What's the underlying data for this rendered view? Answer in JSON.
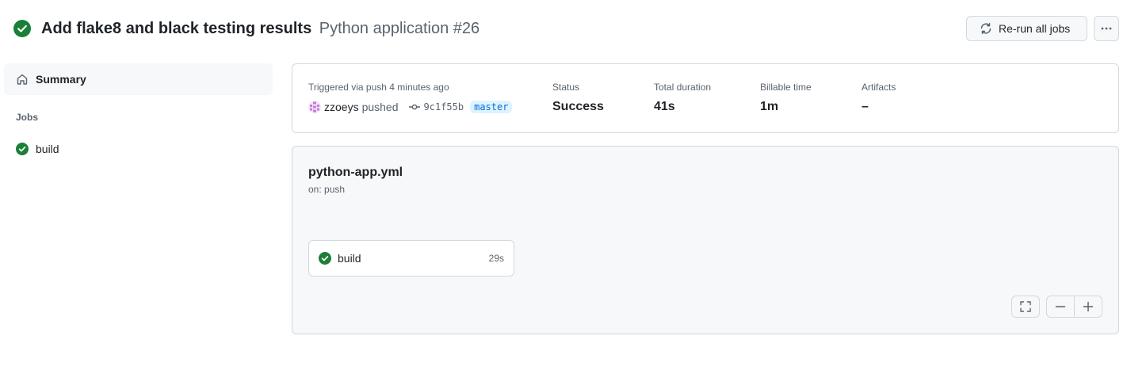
{
  "header": {
    "title": "Add flake8 and black testing results",
    "subtitle": "Python application #26",
    "rerun_label": "Re-run all jobs",
    "more_icon": "kebab-horizontal-icon",
    "status_icon": "check-circle-fill-icon"
  },
  "sidebar": {
    "summary_label": "Summary",
    "summary_icon": "home-icon",
    "jobs_heading": "Jobs",
    "jobs": [
      {
        "label": "build",
        "status": "success"
      }
    ]
  },
  "run_summary": {
    "triggered_label": "Triggered via push 4 minutes ago",
    "actor": "zzoeys",
    "action": "pushed",
    "commit_sha": "9c1f55b",
    "branch": "master",
    "stats": [
      {
        "label": "Status",
        "value": "Success"
      },
      {
        "label": "Total duration",
        "value": "41s"
      },
      {
        "label": "Billable time",
        "value": "1m"
      },
      {
        "label": "Artifacts",
        "value": "–"
      }
    ]
  },
  "workflow": {
    "file": "python-app.yml",
    "trigger": "on: push",
    "jobs": [
      {
        "name": "build",
        "duration": "29s",
        "status": "success"
      }
    ],
    "controls": {
      "fit_icon": "screen-full-icon",
      "zoom_out_icon": "dash-icon",
      "zoom_in_icon": "plus-icon"
    }
  },
  "colors": {
    "success": "#1a7f37",
    "border": "#d1d9e0",
    "muted_text": "#59636e",
    "branch_bg": "#ddf4ff",
    "branch_text": "#0969da"
  }
}
